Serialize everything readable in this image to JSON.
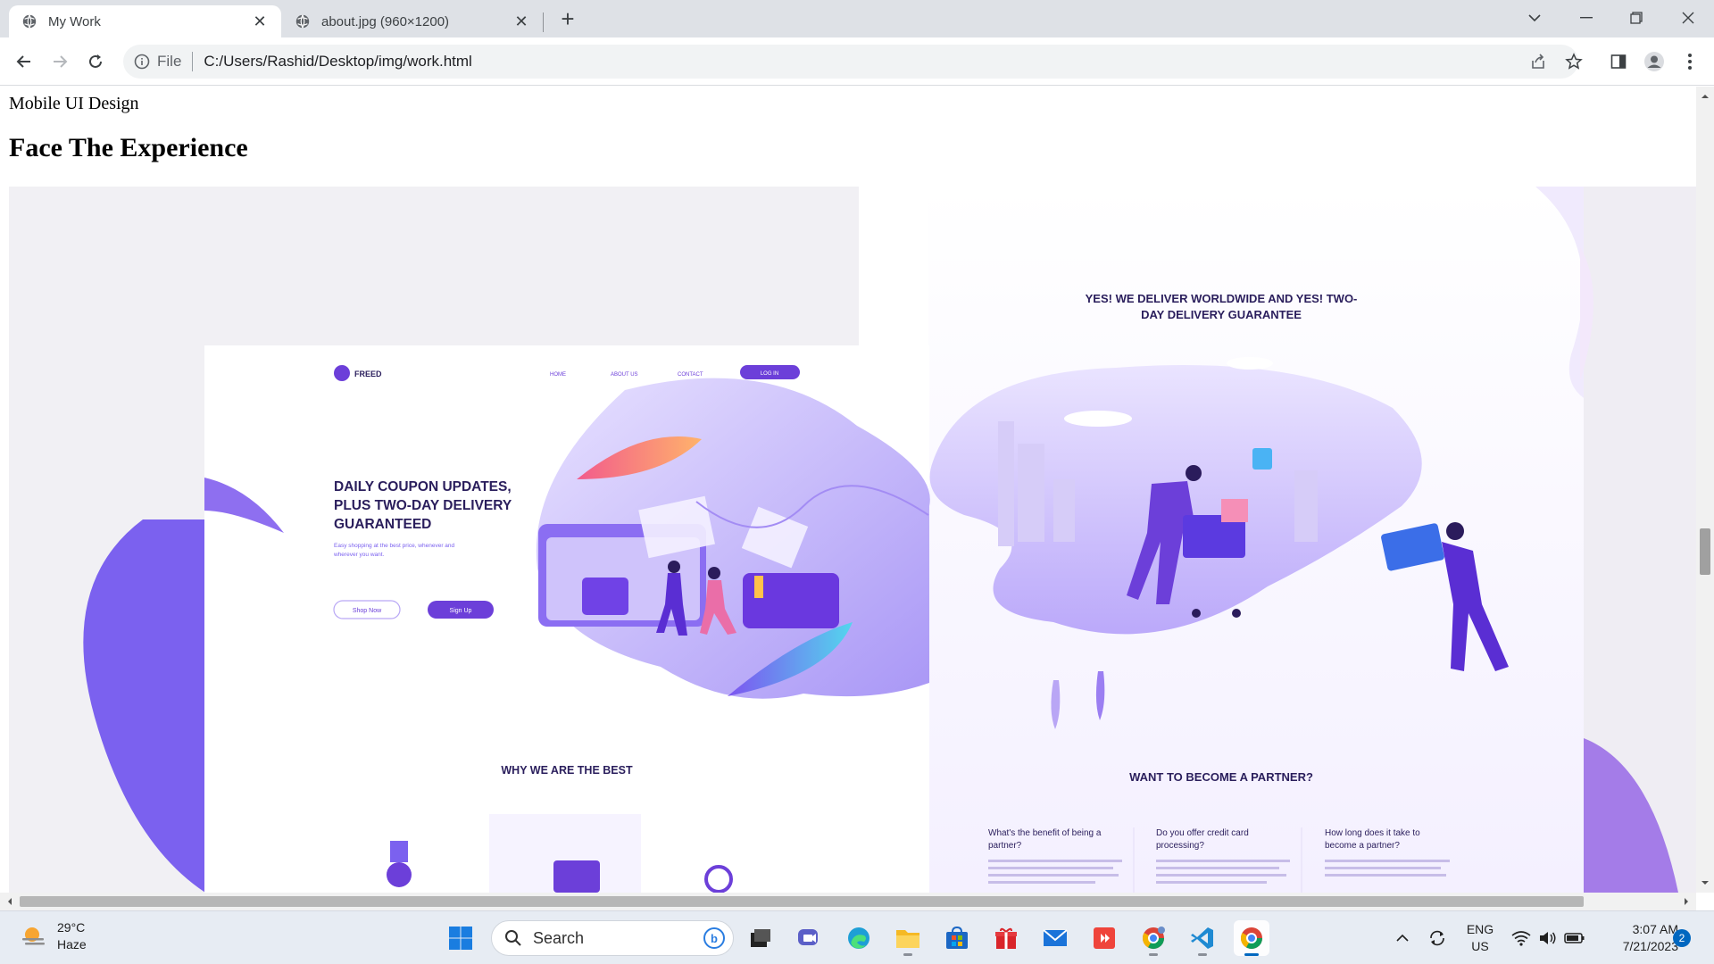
{
  "browser": {
    "tabs": [
      {
        "title": "My Work",
        "active": true
      },
      {
        "title": "about.jpg (960×1200)",
        "active": false
      }
    ],
    "address": {
      "scheme_label": "File",
      "url": "C:/Users/Rashid/Desktop/img/work.html"
    }
  },
  "page": {
    "subtitle": "Mobile UI Design",
    "heading": "Face The Experience",
    "mockup_left": {
      "brand": "FREED",
      "nav": [
        "HOME",
        "ABOUT US",
        "CONTACT"
      ],
      "nav_button": "LOG IN",
      "hero_title_lines": [
        "DAILY COUPON UPDATES,",
        "PLUS TWO-DAY DELIVERY",
        "GUARANTEED"
      ],
      "hero_text_lines": [
        "Easy shopping at the best price, whenever and",
        "wherever you want."
      ],
      "btn_primary": "Shop Now",
      "btn_secondary": "Sign Up",
      "section_title": "WHY WE ARE THE BEST"
    },
    "mockup_right": {
      "banner_lines": [
        "YES! WE DELIVER WORLDWIDE AND YES! TWO-",
        "DAY DELIVERY GUARANTEE"
      ],
      "section_title": "WANT TO BECOME A PARTNER?",
      "faq": [
        {
          "q_lines": [
            "What's the benefit of being a",
            "partner?"
          ]
        },
        {
          "q_lines": [
            "Do you offer credit card",
            "processing?"
          ]
        },
        {
          "q_lines": [
            "How long does it take to",
            "become a partner?"
          ]
        }
      ]
    }
  },
  "taskbar": {
    "weather": {
      "temp": "29°C",
      "condition": "Haze"
    },
    "search_label": "Search",
    "lang": {
      "line1": "ENG",
      "line2": "US"
    },
    "clock": {
      "time": "3:07 AM",
      "date": "7/21/2023"
    },
    "notification_count": "2"
  },
  "colors": {
    "accent": "#6c3fd9",
    "accent_light": "#b9a8f5",
    "blob": "#7a63ee",
    "text_dark": "#2a1e5c"
  }
}
